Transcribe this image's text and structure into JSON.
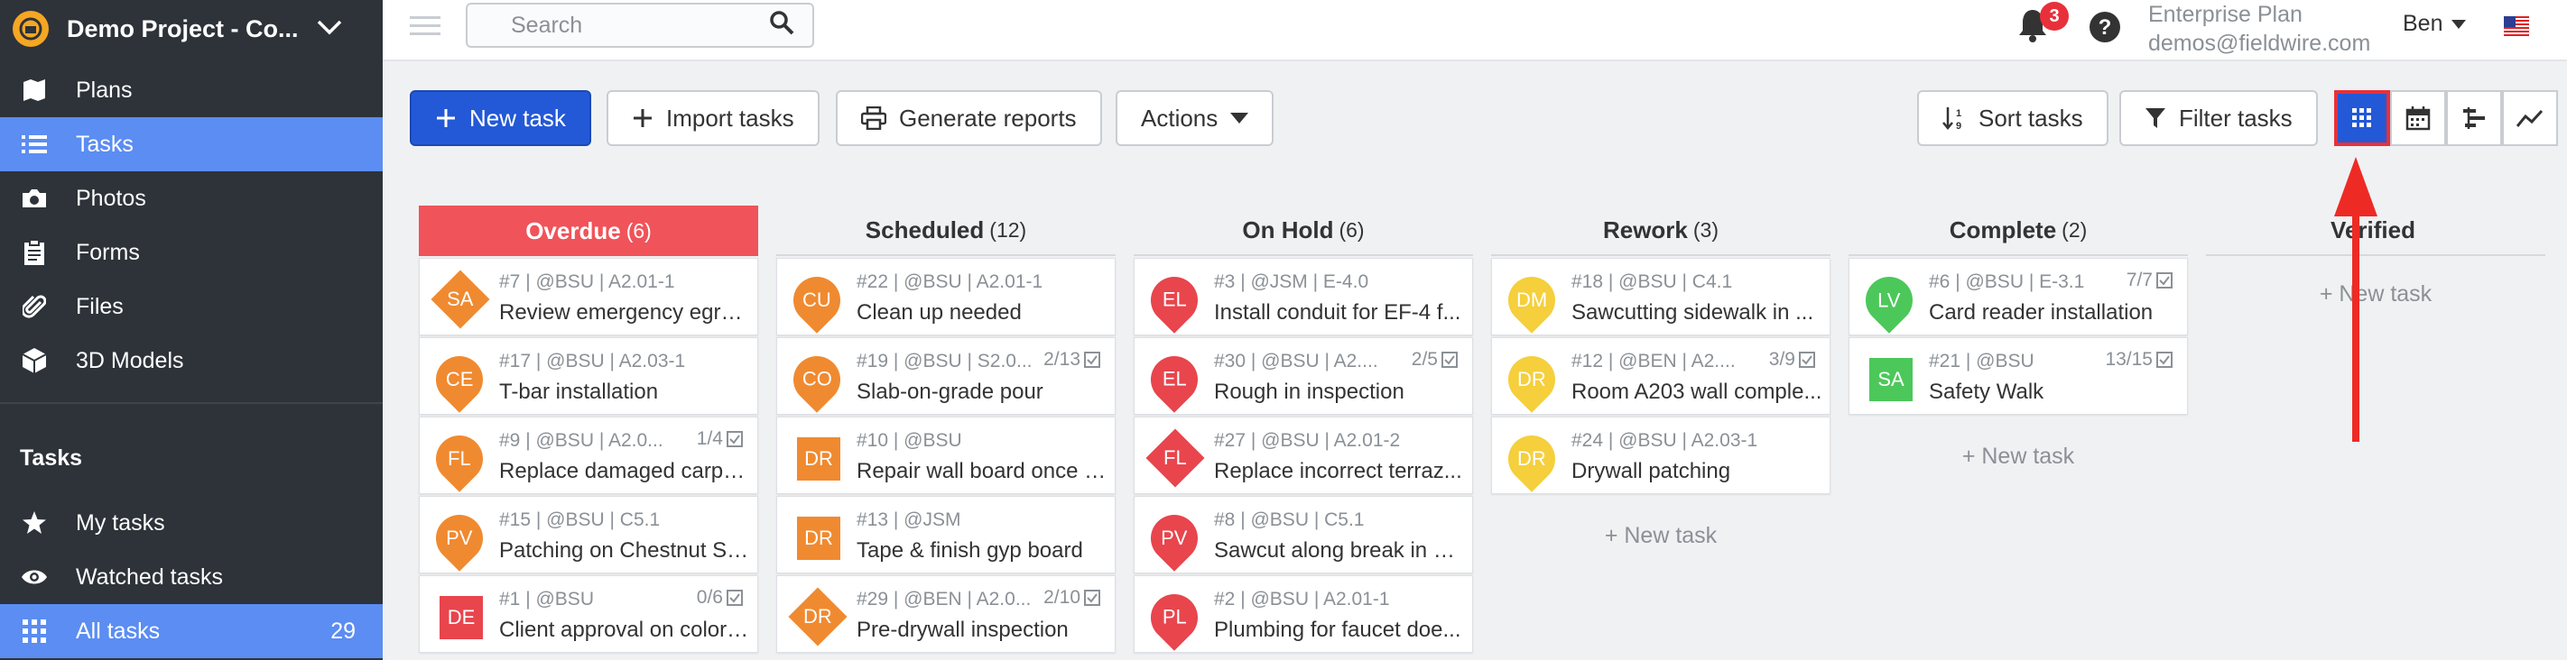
{
  "sidebar": {
    "project": "Demo Project - Co...",
    "items": [
      {
        "label": "Plans"
      },
      {
        "label": "Tasks"
      },
      {
        "label": "Photos"
      },
      {
        "label": "Forms"
      },
      {
        "label": "Files"
      },
      {
        "label": "3D Models"
      }
    ],
    "section": "Tasks",
    "task_items": [
      {
        "label": "My tasks"
      },
      {
        "label": "Watched tasks"
      },
      {
        "label": "All tasks",
        "count": "29"
      }
    ]
  },
  "topbar": {
    "search_placeholder": "Search",
    "notifications": "3",
    "plan": "Enterprise Plan",
    "email": "demos@fieldwire.com",
    "user": "Ben"
  },
  "toolbar": {
    "new_task": "New task",
    "import_tasks": "Import tasks",
    "generate_reports": "Generate reports",
    "actions": "Actions",
    "sort_tasks": "Sort tasks",
    "filter_tasks": "Filter tasks"
  },
  "colors": {
    "accent": "#2359d6",
    "overdue": "#f0535a",
    "sidebar": "#2d3339",
    "sidebar_active": "#5b8df2"
  },
  "columns": [
    {
      "name": "Overdue",
      "count": "(6)",
      "cards": [
        {
          "initials": "SA",
          "shape": "diamond",
          "color": "#f08a30",
          "meta": "#7 | @BSU | A2.01-1",
          "title": "Review emergency egre...",
          "check": ""
        },
        {
          "initials": "CE",
          "shape": "pin",
          "color": "#f08a30",
          "meta": "#17 | @BSU | A2.03-1",
          "title": "T-bar installation",
          "check": ""
        },
        {
          "initials": "FL",
          "shape": "pin",
          "color": "#f08a30",
          "meta": "#9 | @BSU | A2.0...",
          "title": "Replace damaged carpe...",
          "check": "1/4"
        },
        {
          "initials": "PV",
          "shape": "pin",
          "color": "#f08a30",
          "meta": "#15 | @BSU | C5.1",
          "title": "Patching on Chestnut St...",
          "check": ""
        },
        {
          "initials": "DE",
          "shape": "square",
          "color": "#e8454d",
          "meta": "#1 | @BSU",
          "title": "Client approval on color ...",
          "check": "0/6"
        }
      ]
    },
    {
      "name": "Scheduled",
      "count": "(12)",
      "cards": [
        {
          "initials": "CU",
          "shape": "pin",
          "color": "#f08a30",
          "meta": "#22 | @BSU | A2.01-1",
          "title": "Clean up needed",
          "check": ""
        },
        {
          "initials": "CO",
          "shape": "pin",
          "color": "#f08a30",
          "meta": "#19 | @BSU | S2.0...",
          "title": "Slab-on-grade pour",
          "check": "2/13"
        },
        {
          "initials": "DR",
          "shape": "square",
          "color": "#f08a30",
          "meta": "#10 | @BSU",
          "title": "Repair wall board once t...",
          "check": ""
        },
        {
          "initials": "DR",
          "shape": "square",
          "color": "#f08a30",
          "meta": "#13 | @JSM",
          "title": "Tape & finish gyp board",
          "check": ""
        },
        {
          "initials": "DR",
          "shape": "diamond",
          "color": "#f08a30",
          "meta": "#29 | @BEN | A2.0...",
          "title": "Pre-drywall inspection",
          "check": "2/10"
        }
      ]
    },
    {
      "name": "On Hold",
      "count": "(6)",
      "cards": [
        {
          "initials": "EL",
          "shape": "pin",
          "color": "#e8454d",
          "meta": "#3 | @JSM | E-4.0",
          "title": "Install conduit for EF-4 f...",
          "check": ""
        },
        {
          "initials": "EL",
          "shape": "pin",
          "color": "#e8454d",
          "meta": "#30 | @BSU | A2....",
          "title": "Rough in inspection",
          "check": "2/5"
        },
        {
          "initials": "FL",
          "shape": "diamond",
          "color": "#e8454d",
          "meta": "#27 | @BSU | A2.01-2",
          "title": "Replace incorrect terraz...",
          "check": ""
        },
        {
          "initials": "PV",
          "shape": "pin",
          "color": "#e8454d",
          "meta": "#8 | @BSU | C5.1",
          "title": "Sawcut along break in as...",
          "check": ""
        },
        {
          "initials": "PL",
          "shape": "pin",
          "color": "#e8454d",
          "meta": "#2 | @BSU | A2.01-1",
          "title": "Plumbing for faucet doe...",
          "check": ""
        }
      ]
    },
    {
      "name": "Rework",
      "count": "(3)",
      "cards": [
        {
          "initials": "DM",
          "shape": "pin",
          "color": "#f5cf3c",
          "meta": "#18 | @BSU | C4.1",
          "title": "Sawcutting sidewalk in ...",
          "check": ""
        },
        {
          "initials": "DR",
          "shape": "pin",
          "color": "#f5cf3c",
          "meta": "#12 | @BEN | A2....",
          "title": "Room A203 wall comple...",
          "check": "3/9"
        },
        {
          "initials": "DR",
          "shape": "pin",
          "color": "#f5cf3c",
          "meta": "#24 | @BSU | A2.03-1",
          "title": "Drywall patching",
          "check": ""
        }
      ]
    },
    {
      "name": "Complete",
      "count": "(2)",
      "cards": [
        {
          "initials": "LV",
          "shape": "pin",
          "color": "#4cc85a",
          "meta": "#6 | @BSU | E-3.1",
          "title": "Card reader installation",
          "check": "7/7"
        },
        {
          "initials": "SA",
          "shape": "square",
          "color": "#4cc85a",
          "meta": "#21 | @BSU",
          "title": "Safety Walk",
          "check": "13/15"
        }
      ]
    },
    {
      "name": "Verified",
      "count": "",
      "cards": []
    }
  ],
  "new_task_label": "+ New task"
}
